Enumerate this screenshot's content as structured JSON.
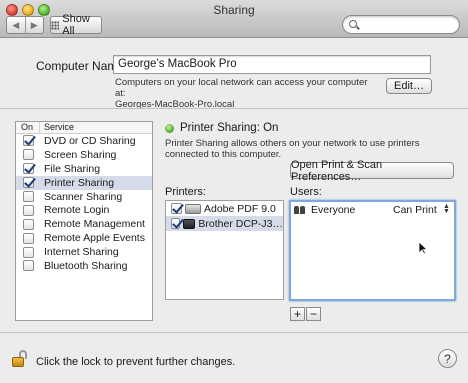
{
  "window": {
    "title": "Sharing"
  },
  "toolbar": {
    "back_icon": "back-arrow-icon",
    "forward_icon": "forward-arrow-icon",
    "show_all_label": "Show All",
    "search_placeholder": ""
  },
  "computer": {
    "label": "Computer Name:",
    "name": "George’s MacBook Pro",
    "help_line1": "Computers on your local network can access your computer at:",
    "help_line2": "Georges-MacBook-Pro.local",
    "edit_label": "Edit…"
  },
  "services": {
    "header_on": "On",
    "header_service": "Service",
    "items": [
      {
        "label": "DVD or CD Sharing",
        "checked": true,
        "selected": false
      },
      {
        "label": "Screen Sharing",
        "checked": false,
        "selected": false
      },
      {
        "label": "File Sharing",
        "checked": true,
        "selected": false
      },
      {
        "label": "Printer Sharing",
        "checked": true,
        "selected": true
      },
      {
        "label": "Scanner Sharing",
        "checked": false,
        "selected": false
      },
      {
        "label": "Remote Login",
        "checked": false,
        "selected": false
      },
      {
        "label": "Remote Management",
        "checked": false,
        "selected": false
      },
      {
        "label": "Remote Apple Events",
        "checked": false,
        "selected": false
      },
      {
        "label": "Internet Sharing",
        "checked": false,
        "selected": false
      },
      {
        "label": "Bluetooth Sharing",
        "checked": false,
        "selected": false
      }
    ]
  },
  "detail": {
    "status": "Printer Sharing: On",
    "status_color": "#4fae2a",
    "description": "Printer Sharing allows others on your network to use printers connected to this computer.",
    "open_prefs_label": "Open Print & Scan Preferences…",
    "printers_label": "Printers:",
    "users_label": "Users:",
    "printers": [
      {
        "name": "Adobe PDF 9.0",
        "checked": true,
        "selected": false
      },
      {
        "name": "Brother DCP-J3…",
        "checked": true,
        "selected": true
      }
    ],
    "users": [
      {
        "name": "Everyone",
        "permission": "Can Print"
      }
    ],
    "add_label": "+",
    "remove_label": "−"
  },
  "footer": {
    "lock_text": "Click the lock to prevent further changes.",
    "help_label": "?"
  }
}
